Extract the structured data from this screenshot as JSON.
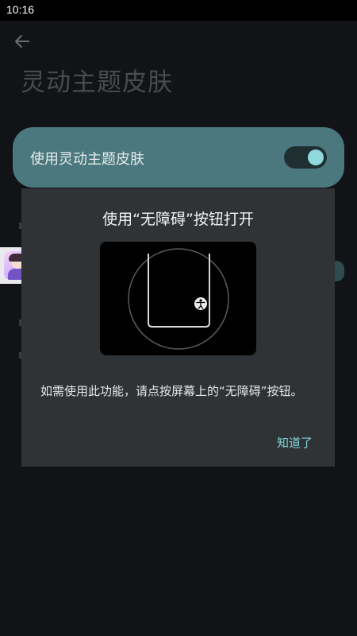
{
  "status_bar": {
    "time": "10:16"
  },
  "header": {
    "title": "灵动主题皮肤"
  },
  "setting": {
    "label": "使用灵动主题皮肤",
    "enabled": true
  },
  "dialog": {
    "title": "使用“无障碍”按钮打开",
    "message": "如需使用此功能，请点按屏幕上的“无障碍”按钮。",
    "ok_label": "知道了"
  },
  "colors": {
    "accent_card": "#4a787e",
    "switch_knob": "#8fd9de",
    "dialog_bg": "#303335",
    "link": "#7fd4dc"
  },
  "icons": {
    "back": "arrow-left-icon",
    "accessibility": "accessibility-icon"
  }
}
